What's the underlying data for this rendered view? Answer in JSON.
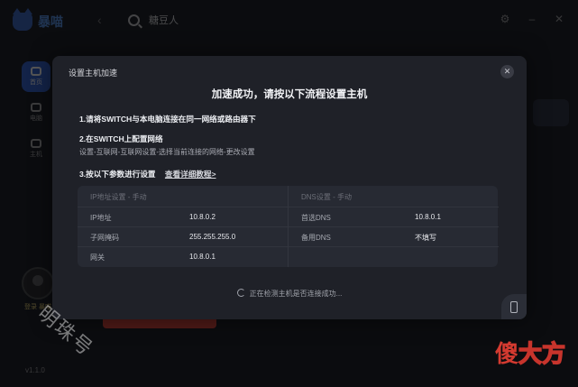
{
  "app": {
    "logo_text": "暴喵",
    "version": "v1.1.0",
    "login_text": "登录 暴喵"
  },
  "search": {
    "value": "糖豆人"
  },
  "sidebar": {
    "items": [
      {
        "label": "首页"
      },
      {
        "label": "电脑"
      },
      {
        "label": "主机"
      }
    ]
  },
  "modal": {
    "title": "设置主机加速",
    "headline": "加速成功，请按以下流程设置主机",
    "step1": "1.请将SWITCH与本电脑连接在同一网络或路由器下",
    "step2": "2.在SWITCH上配置网络",
    "step2_desc": "设置-互联网-互联网设置-选择当前连接的网络-更改设置",
    "step3": "3.按以下参数进行设置",
    "detail_link": "查看详细教程>",
    "ip_section": {
      "header": "IP地址设置 - 手动",
      "rows": [
        {
          "label": "IP地址",
          "value": "10.8.0.2"
        },
        {
          "label": "子网掩码",
          "value": "255.255.255.0"
        },
        {
          "label": "网关",
          "value": "10.8.0.1"
        }
      ]
    },
    "dns_section": {
      "header": "DNS设置 - 手动",
      "rows": [
        {
          "label": "首选DNS",
          "value": "10.8.0.1"
        },
        {
          "label": "备用DNS",
          "value": "不填写"
        }
      ]
    },
    "detecting_text": "正在检测主机是否连接成功..."
  },
  "watermarks": {
    "left": "明珠号",
    "right_a": "傻",
    "right_b": "大方"
  }
}
